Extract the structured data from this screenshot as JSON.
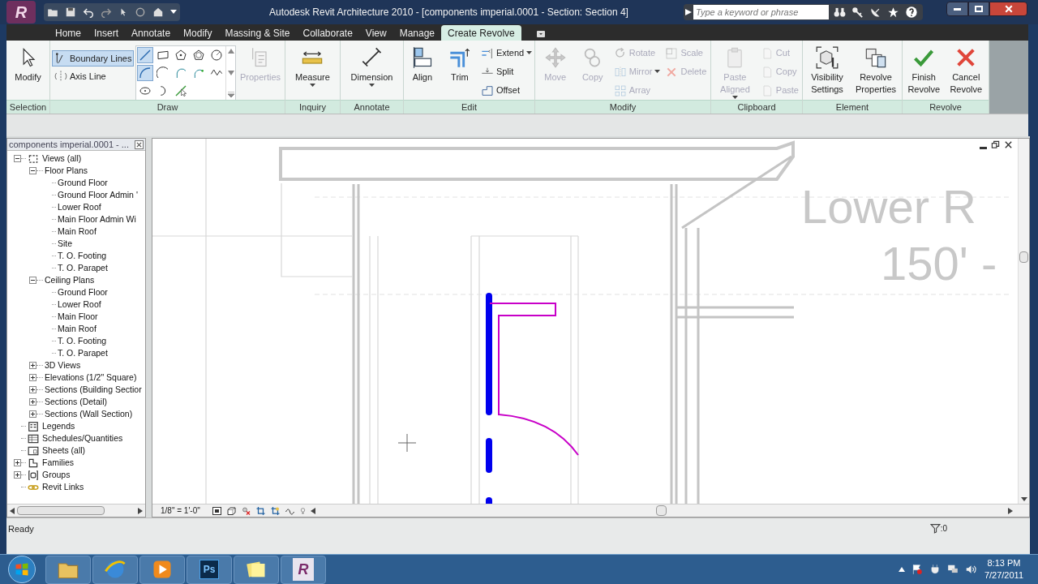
{
  "title_bar": {
    "app_button": "R",
    "title": "Autodesk Revit Architecture 2010 - [components imperial.0001 - Section: Section 4]",
    "search": {
      "placeholder": "Type a keyword or phrase"
    }
  },
  "ribbon_tabs": [
    {
      "label": "Home",
      "selected": false
    },
    {
      "label": "Insert",
      "selected": false
    },
    {
      "label": "Annotate",
      "selected": false
    },
    {
      "label": "Modify",
      "selected": false
    },
    {
      "label": "Massing & Site",
      "selected": false
    },
    {
      "label": "Collaborate",
      "selected": false
    },
    {
      "label": "View",
      "selected": false
    },
    {
      "label": "Manage",
      "selected": false
    },
    {
      "label": "Create Revolve",
      "selected": true
    }
  ],
  "ribbon_panels": [
    {
      "label": "Selection",
      "groups": [
        {
          "kind": "large",
          "label": "Modify",
          "disabled": false,
          "dropdown": false
        }
      ]
    },
    {
      "label": "Draw",
      "groups": [
        {
          "kind": "modes",
          "items": [
            {
              "label": "Boundary Lines",
              "selected": true
            },
            {
              "label": "Axis Line",
              "selected": false
            }
          ]
        },
        {
          "kind": "gallery"
        },
        {
          "kind": "large",
          "label": "Properties",
          "disabled": true,
          "dropdown": false
        }
      ]
    },
    {
      "label": "Inquiry",
      "groups": [
        {
          "kind": "large",
          "label": "Measure",
          "disabled": false,
          "dropdown": true
        }
      ]
    },
    {
      "label": "Annotate",
      "groups": [
        {
          "kind": "large",
          "label": "Dimension",
          "disabled": false,
          "dropdown": true
        }
      ]
    },
    {
      "label": "Edit",
      "groups": [
        {
          "kind": "large",
          "label": "Align",
          "disabled": false,
          "dropdown": false
        },
        {
          "kind": "large",
          "label": "Trim",
          "disabled": false,
          "dropdown": false
        },
        {
          "kind": "stack",
          "tools": [
            {
              "label": "Extend",
              "disabled": false,
              "dropdown": true
            },
            {
              "label": "Split",
              "disabled": false,
              "dropdown": false
            },
            {
              "label": "Offset",
              "disabled": false,
              "dropdown": false
            }
          ]
        }
      ]
    },
    {
      "label": "Modify",
      "groups": [
        {
          "kind": "large",
          "label": "Move",
          "disabled": true,
          "dropdown": false
        },
        {
          "kind": "large",
          "label": "Copy",
          "disabled": true,
          "dropdown": false
        },
        {
          "kind": "stack",
          "tools": [
            {
              "label": "Rotate",
              "disabled": true,
              "dropdown": false
            },
            {
              "label": "Mirror",
              "disabled": true,
              "dropdown": true
            },
            {
              "label": "Array",
              "disabled": true,
              "dropdown": false
            }
          ]
        },
        {
          "kind": "stack",
          "tools": [
            {
              "label": "Scale",
              "disabled": true,
              "dropdown": false
            },
            {
              "label": "Delete",
              "disabled": true,
              "dropdown": false
            }
          ]
        }
      ]
    },
    {
      "label": "Clipboard",
      "groups": [
        {
          "kind": "large",
          "label": "Paste Aligned",
          "disabled": true,
          "dropdown": true
        },
        {
          "kind": "stack",
          "tools": [
            {
              "label": "Cut",
              "disabled": true,
              "dropdown": false
            },
            {
              "label": "Copy",
              "disabled": true,
              "dropdown": false
            },
            {
              "label": "Paste",
              "disabled": true,
              "dropdown": false
            }
          ]
        }
      ]
    },
    {
      "label": "Element",
      "groups": [
        {
          "kind": "large",
          "label": "Visibility Settings",
          "disabled": false,
          "dropdown": false
        },
        {
          "kind": "large",
          "label": "Revolve Properties",
          "disabled": false,
          "dropdown": false
        }
      ]
    },
    {
      "label": "Revolve",
      "groups": [
        {
          "kind": "large",
          "label": "Finish Revolve",
          "disabled": false,
          "dropdown": false
        },
        {
          "kind": "large",
          "label": "Cancel Revolve",
          "disabled": false,
          "dropdown": false
        }
      ]
    }
  ],
  "project_browser": {
    "title": "components imperial.0001 - ...",
    "tree": [
      {
        "label": "Views (all)",
        "kind": "views",
        "expanded": true,
        "children": [
          {
            "label": "Floor Plans",
            "expanded": true,
            "children": [
              {
                "label": "Ground Floor"
              },
              {
                "label": "Ground Floor Admin '"
              },
              {
                "label": "Lower Roof"
              },
              {
                "label": "Main Floor Admin Wi"
              },
              {
                "label": "Main Roof"
              },
              {
                "label": "Site"
              },
              {
                "label": "T. O. Footing"
              },
              {
                "label": "T. O. Parapet"
              }
            ]
          },
          {
            "label": "Ceiling Plans",
            "expanded": true,
            "children": [
              {
                "label": "Ground Floor"
              },
              {
                "label": "Lower Roof"
              },
              {
                "label": "Main Floor"
              },
              {
                "label": "Main Roof"
              },
              {
                "label": "T. O. Footing"
              },
              {
                "label": "T. O. Parapet"
              }
            ]
          },
          {
            "label": "3D Views",
            "expanded": false
          },
          {
            "label": "Elevations (1/2\" Square)",
            "expanded": false
          },
          {
            "label": "Sections (Building Sectior",
            "expanded": false
          },
          {
            "label": "Sections (Detail)",
            "expanded": false
          },
          {
            "label": "Sections (Wall Section)",
            "expanded": false
          }
        ]
      },
      {
        "label": "Legends",
        "kind": "legends"
      },
      {
        "label": "Schedules/Quantities",
        "kind": "schedules"
      },
      {
        "label": "Sheets (all)",
        "kind": "sheets"
      },
      {
        "label": "Families",
        "kind": "families",
        "expanded": false
      },
      {
        "label": "Groups",
        "kind": "groups",
        "expanded": false
      },
      {
        "label": "Revit Links",
        "kind": "links"
      }
    ]
  },
  "view": {
    "level_head": {
      "name": "Lower R",
      "elevation": "150' -"
    },
    "scale": "1/8\" = 1'-0\""
  },
  "status_bar": {
    "message": "Ready",
    "filter_count": ":0"
  },
  "taskbar": {
    "apps": [
      {
        "kind": "folder"
      },
      {
        "kind": "browser"
      },
      {
        "kind": "media"
      },
      {
        "kind": "photoshop",
        "label": "Ps"
      },
      {
        "kind": "notes"
      },
      {
        "kind": "revit",
        "label": "R"
      }
    ],
    "time": "8:13 PM",
    "date": "7/27/2011"
  }
}
